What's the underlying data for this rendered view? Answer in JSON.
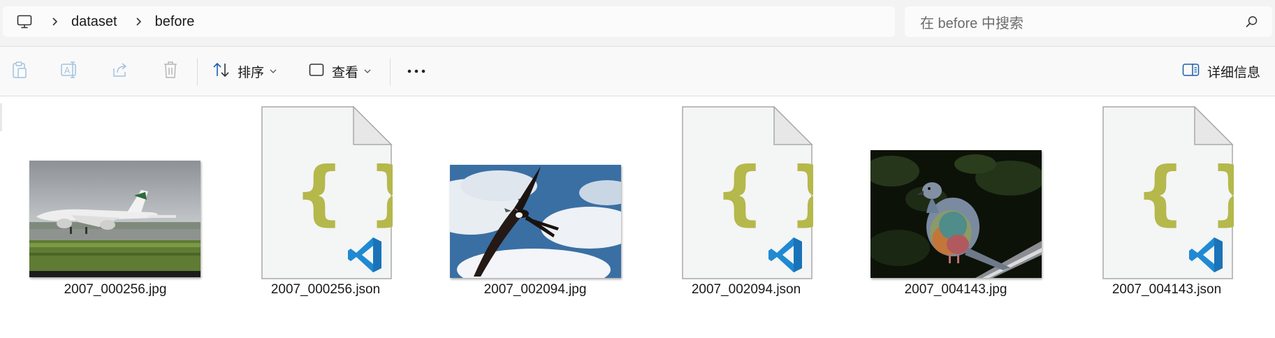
{
  "address_bar": {
    "breadcrumbs": [
      "dataset",
      "before"
    ]
  },
  "search": {
    "placeholder": "在 before 中搜索"
  },
  "toolbar": {
    "sort_label": "排序",
    "view_label": "查看",
    "details_label": "详细信息"
  },
  "files": [
    {
      "name": "2007_000256.jpg",
      "type": "image"
    },
    {
      "name": "2007_000256.json",
      "type": "json"
    },
    {
      "name": "2007_002094.jpg",
      "type": "image"
    },
    {
      "name": "2007_002094.json",
      "type": "json"
    },
    {
      "name": "2007_004143.jpg",
      "type": "image"
    },
    {
      "name": "2007_004143.json",
      "type": "json"
    }
  ],
  "colors": {
    "json_brace": "#b5b84a",
    "vscode_blue": "#1f8ad2",
    "accent": "#005fb8"
  },
  "icons": [
    "computer-icon",
    "chevron-right-icon",
    "search-icon",
    "clipboard-icon",
    "rename-icon",
    "share-icon",
    "trash-icon",
    "sort-icon",
    "view-icon",
    "more-icon",
    "details-pane-icon",
    "json-file-icon",
    "vscode-icon"
  ]
}
